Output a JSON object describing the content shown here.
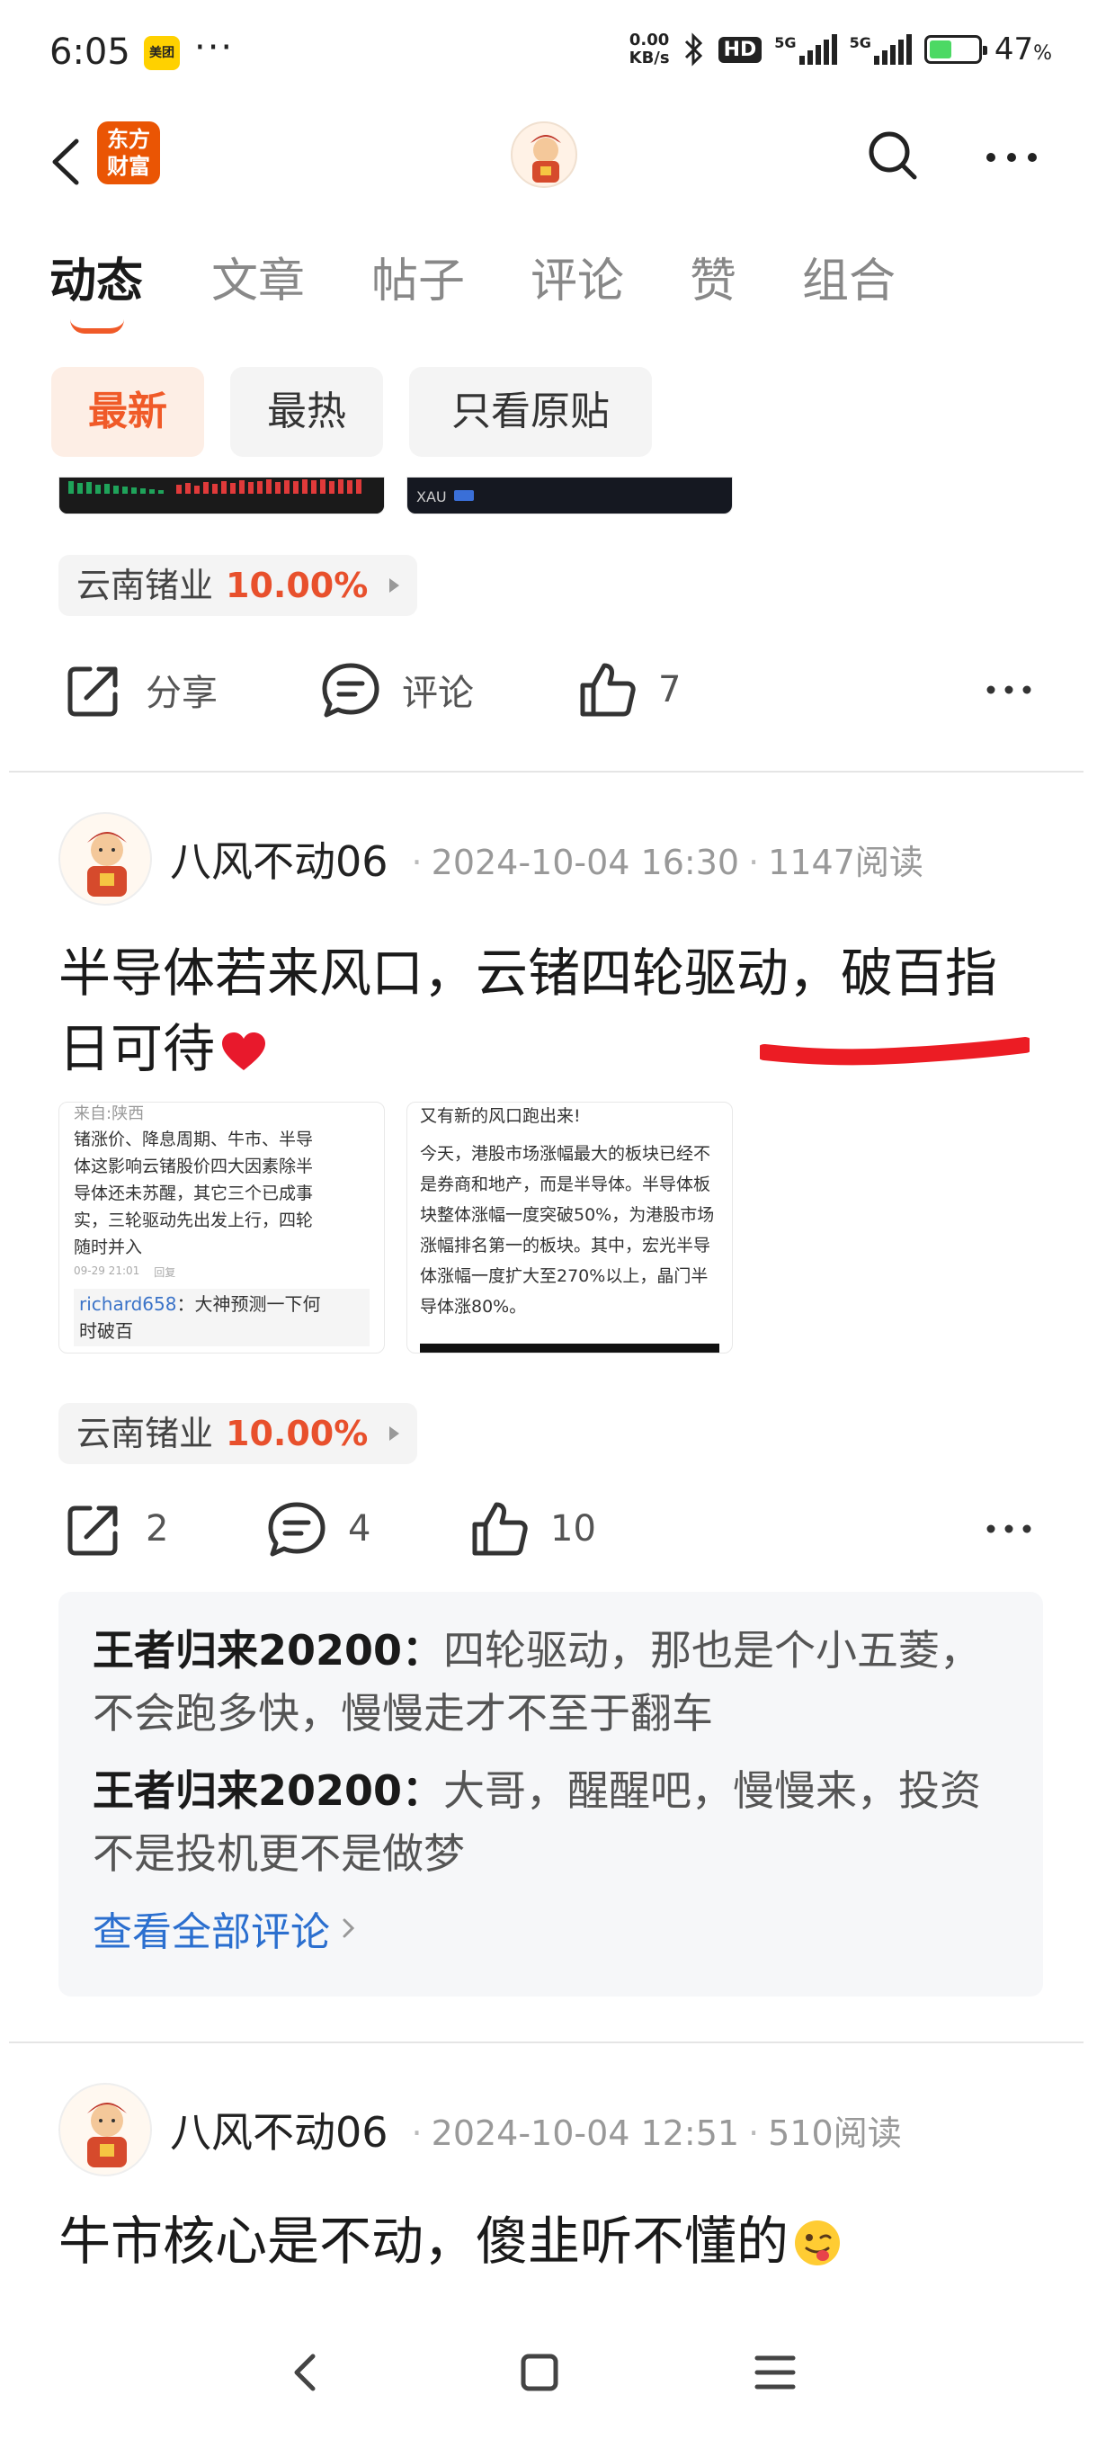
{
  "status": {
    "time": "6:05",
    "app_badge": "美团",
    "dots": "···",
    "net_speed_top": "0.00",
    "net_speed_bottom": "KB/s",
    "hd": "HD",
    "sig1": "5G",
    "sig2": "5G",
    "battery_pct": "47",
    "battery_unit": "%",
    "battery_level": 0.47
  },
  "header": {
    "logo_line1": "东方",
    "logo_line2": "财富"
  },
  "tabs": [
    {
      "label": "动态",
      "active": true
    },
    {
      "label": "文章",
      "active": false
    },
    {
      "label": "帖子",
      "active": false
    },
    {
      "label": "评论",
      "active": false
    },
    {
      "label": "赞",
      "active": false
    },
    {
      "label": "组合",
      "active": false
    }
  ],
  "filters": [
    {
      "label": "最新",
      "active": true
    },
    {
      "label": "最热",
      "active": false
    },
    {
      "label": "只看原贴",
      "active": false
    }
  ],
  "post0": {
    "stock_name": "云南锗业",
    "stock_pct": "10.00%",
    "share_label": "分享",
    "comment_label": "评论",
    "like_count": "7",
    "thumb2_text": "XAU"
  },
  "post1": {
    "author": "八风不动06",
    "time": "2024-10-04 16:30",
    "reads": "1147阅读",
    "text_line1": "半导体若来风口，云锗四轮驱动，破百指",
    "text_line2": "日可待",
    "thumb1": {
      "head": "来自:陕西",
      "lines": [
        "锗涨价、降息周期、牛市、半导",
        "体这影响云锗股价四大因素除半",
        "导体还未苏醒，其它三个已成事",
        "实，三轮驱动先出发上行，四轮",
        "随时并入"
      ],
      "date": "09-29 21:01",
      "reply_btn": "回复",
      "reply_user": "richard658",
      "reply_text": "：大神预测一下何",
      "reply_text2": "时破百"
    },
    "thumb2": {
      "head": "又有新的风口跑出来!",
      "lines": [
        "今天，港股市场涨幅最大的板块已经不",
        "是券商和地产，而是半导体。半导体板",
        "块整体涨幅一度突破50%，为港股市场",
        "涨幅排名第一的板块。其中，宏光半导",
        "体涨幅一度扩大至270%以上，晶门半",
        "导体涨80%。"
      ]
    },
    "stock_name": "云南锗业",
    "stock_pct": "10.00%",
    "share_count": "2",
    "comment_count": "4",
    "like_count": "10",
    "comments": [
      {
        "user": "王者归来20200：",
        "text": "四轮驱动，那也是个小五菱，不会跑多快，慢慢走才不至于翻车"
      },
      {
        "user": "王者归来20200：",
        "text": "大哥，醒醒吧，慢慢来，投资不是投机更不是做梦"
      }
    ],
    "see_all": "查看全部评论"
  },
  "post2": {
    "author": "八风不动06",
    "time": "2024-10-04 12:51",
    "reads": "510阅读",
    "text": "牛市核心是不动，傻韭听不懂的"
  },
  "colors": {
    "accent": "#f05a28",
    "stock_red": "#e8502c",
    "link_blue": "#2b6fcf",
    "logo_orange": "#ea5504"
  }
}
